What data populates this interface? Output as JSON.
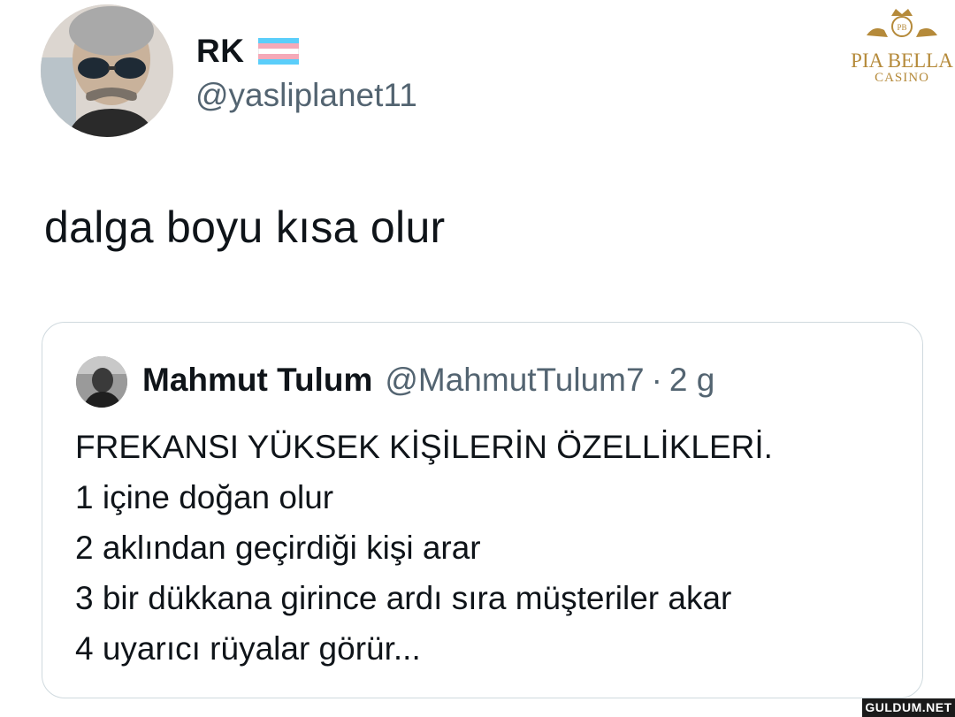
{
  "author": {
    "display_name": "RK",
    "handle": "@yasliplanet11",
    "avatar": "profile-photo-icon",
    "flag_colors": [
      "#5BCEFA",
      "#F5A9B8",
      "#FFFFFF",
      "#F5A9B8",
      "#5BCEFA"
    ]
  },
  "tweet": {
    "text": "dalga boyu kısa olur"
  },
  "quoted": {
    "display_name": "Mahmut Tulum",
    "handle": "@MahmutTulum7",
    "separator": "·",
    "time": "2 g",
    "lines": [
      "FREKANSI YÜKSEK KİŞİLERİN ÖZELLİKLERİ.",
      "1 içine doğan olur",
      "2 aklından geçirdiği kişi arar",
      "3 bir dükkana girince ardı sıra müşteriler akar",
      "4 uyarıcı rüyalar görür..."
    ]
  },
  "logo": {
    "brand": "PIA BELLA",
    "subbrand": "CASINO",
    "color": "#b58a3a"
  },
  "watermark": {
    "text": "GULDUM.NET"
  },
  "colors": {
    "text": "#0f1419",
    "secondary": "#536471",
    "border": "#cfd9de"
  }
}
